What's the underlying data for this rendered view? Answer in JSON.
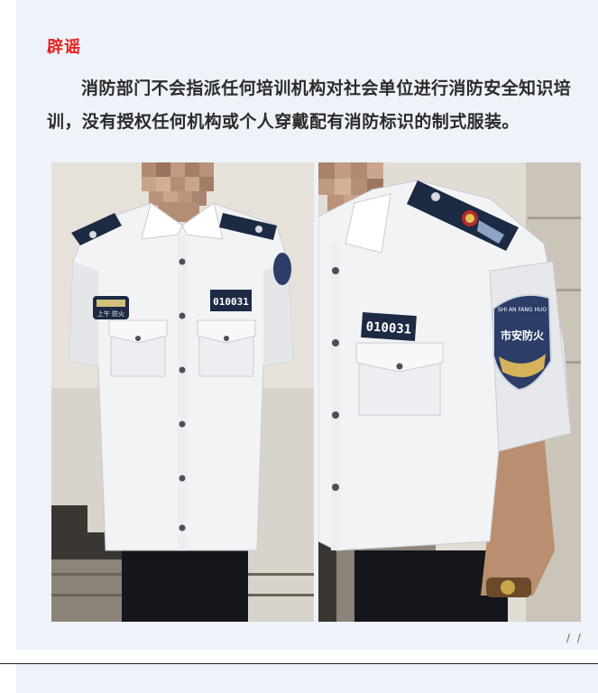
{
  "article": {
    "tag": "辟谣",
    "paragraph": "消防部门不会指派任何培训机构对社会单位进行消防安全知识培训，没有授权任何机构或个人穿戴配有消防标识的制式服装。"
  },
  "photos": {
    "left": {
      "badge_number": "010031",
      "patch_text": "上午 防火"
    },
    "right": {
      "badge_number": "010031",
      "patch_arc_text": "SHI AN FANG HUO",
      "patch_text": "市安防火"
    }
  },
  "footer": {
    "corner_mark": "/ /"
  },
  "colors": {
    "tag": "#e4231f",
    "text": "#2b2b2b",
    "card_background": "#eef3fa",
    "shirt": "#f2f3f5",
    "epaulette": "#1c2a44",
    "trousers": "#15161c"
  }
}
